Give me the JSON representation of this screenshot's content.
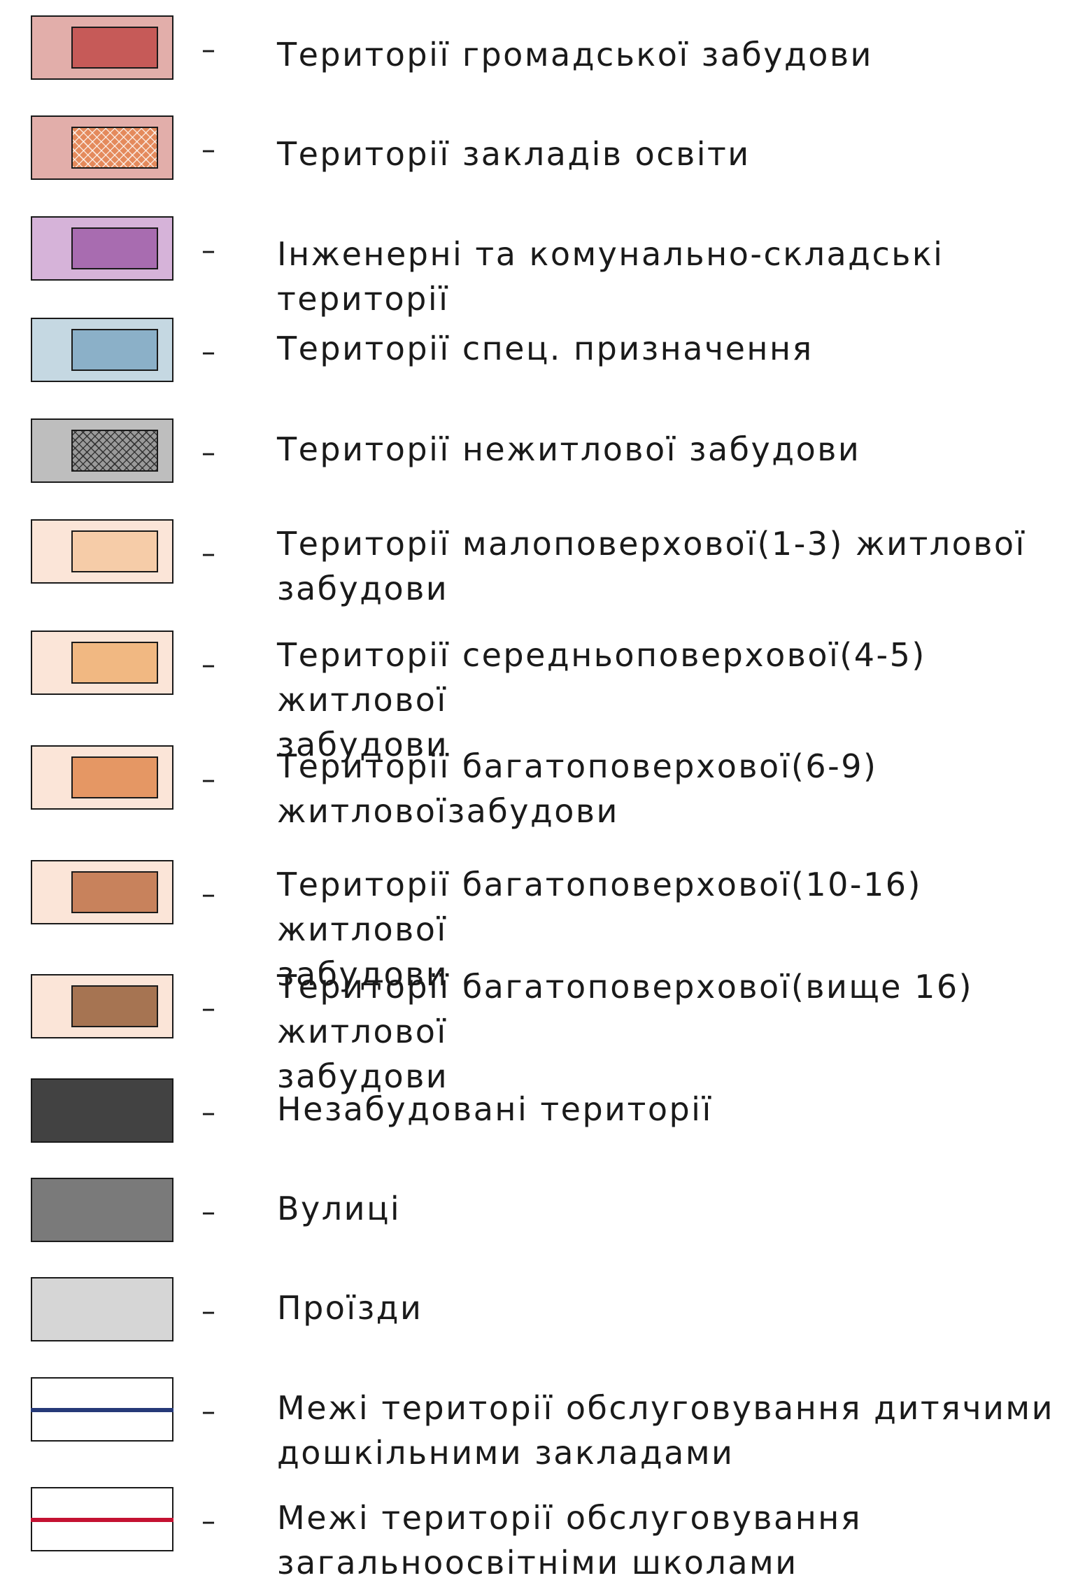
{
  "legend": {
    "items": [
      {
        "label": "Території громадської забудови",
        "outer": "#e2aeaa",
        "inner": "#c65a58",
        "pattern": "none"
      },
      {
        "label": "Території закладів освіти",
        "outer": "#e2aeaa",
        "inner": "#e48a5c",
        "pattern": "crosshatch"
      },
      {
        "label": "Інженерні та комунально-складські території",
        "outer": "#d6b3d9",
        "inner": "#a86cb0",
        "pattern": "none"
      },
      {
        "label": "Території спец. призначення",
        "outer": "#c5d8e2",
        "inner": "#8bb0c8",
        "pattern": "none"
      },
      {
        "label": "Території нежитлової забудови",
        "outer": "#bebebe",
        "inner": "#9a9a9a",
        "pattern": "crosshatch-dark"
      },
      {
        "label": "Території малоповерхової(1-3) житлової\nзабудови",
        "outer": "#fbe5d8",
        "inner": "#f6cca8",
        "pattern": "none"
      },
      {
        "label": "Території середньоповерхової(4-5) житлової\nзабудови",
        "outer": "#fbe5d8",
        "inner": "#f1b882",
        "pattern": "none"
      },
      {
        "label": "Території багатоповерхової(6-9)\nжитловоїзабудови",
        "outer": "#fbe5d8",
        "inner": "#e59764",
        "pattern": "none"
      },
      {
        "label": "Території багатоповерхової(10-16) житлової\nзабудови",
        "outer": "#fbe5d8",
        "inner": "#c8825c",
        "pattern": "none"
      },
      {
        "label": "Території багатоповерхової(вище 16) житлової\nзабудови",
        "outer": "#fbe5d8",
        "inner": "#a67452",
        "pattern": "none"
      },
      {
        "label": "Незабудовані території",
        "outer": "#424242",
        "inner": null,
        "pattern": "none"
      },
      {
        "label": "Вулиці",
        "outer": "#7a7a7a",
        "inner": null,
        "pattern": "none"
      },
      {
        "label": "Проїзди",
        "outer": "#d6d6d6",
        "inner": null,
        "pattern": "none"
      },
      {
        "label": "Межі території обслуговування дитячими\nдошкільними закладами",
        "outer": "#ffffff",
        "inner": null,
        "line": "#263a78",
        "pattern": "none"
      },
      {
        "label": "Межі території обслуговування\nзагальноосвітніми школами",
        "outer": "#ffffff",
        "inner": null,
        "line": "#c41232",
        "pattern": "none"
      }
    ],
    "dash": "–"
  }
}
